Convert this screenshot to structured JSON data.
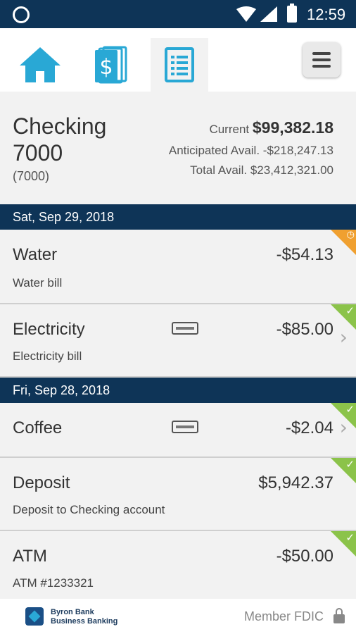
{
  "status_bar": {
    "time": "12:59"
  },
  "nav": {
    "icons": [
      "home-icon",
      "dollar-icon",
      "ledger-icon",
      "menu-icon"
    ],
    "accent": "#29a8d5"
  },
  "account": {
    "name": "Checking 7000",
    "number": "(7000)",
    "current_label": "Current",
    "current_value": "$99,382.18",
    "anticipated_label": "Anticipated Avail.",
    "anticipated_value": "-$218,247.13",
    "total_label": "Total Avail.",
    "total_value": "$23,412,321.00"
  },
  "dates": [
    "Sat, Sep 29, 2018",
    "Fri, Sep 28, 2018"
  ],
  "transactions": [
    {
      "title": "Water",
      "desc": "Water bill",
      "amount": "-$54.13",
      "status": "pending"
    },
    {
      "title": "Electricity",
      "desc": "Electricity bill",
      "amount": "-$85.00",
      "status": "cleared"
    },
    {
      "title": "Coffee",
      "desc": "",
      "amount": "-$2.04",
      "status": "cleared"
    },
    {
      "title": "Deposit",
      "desc": "Deposit to Checking account",
      "amount": "$5,942.37",
      "status": "cleared"
    },
    {
      "title": "ATM",
      "desc": "ATM #1233321",
      "amount": "-$50.00",
      "status": "cleared"
    }
  ],
  "footer": {
    "brand_line1": "Byron Bank",
    "brand_line2": "Business Banking",
    "fdic": "Member FDIC"
  },
  "colors": {
    "header": "#0e3457",
    "cleared": "#8bc34a",
    "pending": "#f0a030"
  }
}
